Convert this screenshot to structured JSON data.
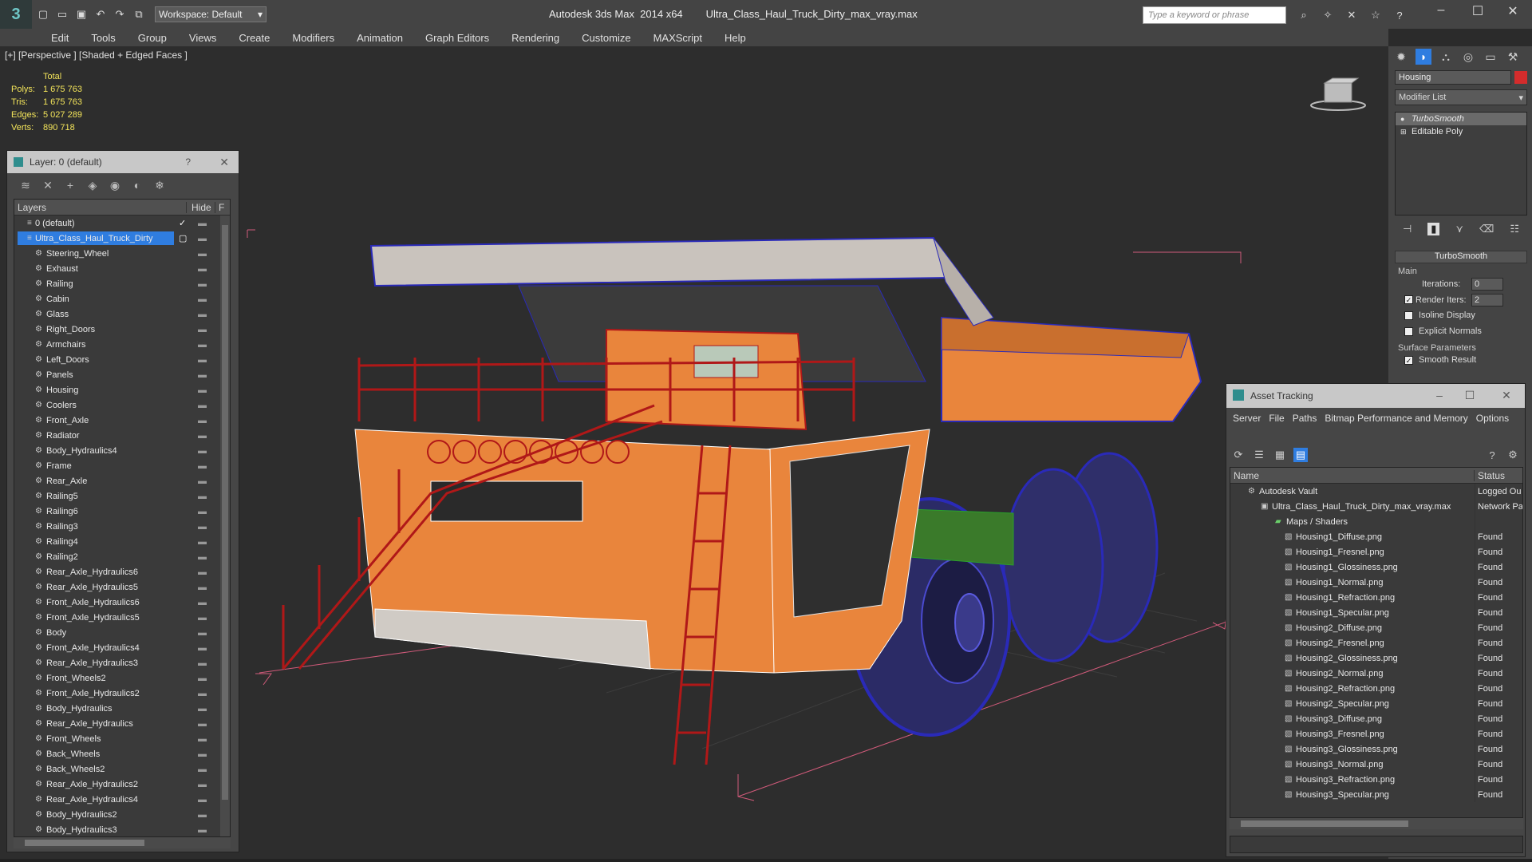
{
  "titlebar": {
    "workspace": "Workspace: Default",
    "app_title": "Autodesk 3ds Max  2014 x64",
    "file_name": "Ultra_Class_Haul_Truck_Dirty_max_vray.max",
    "search_placeholder": "Type a keyword or phrase"
  },
  "menu": [
    "Edit",
    "Tools",
    "Group",
    "Views",
    "Create",
    "Modifiers",
    "Animation",
    "Graph Editors",
    "Rendering",
    "Customize",
    "MAXScript",
    "Help"
  ],
  "viewport": {
    "label": "[+] [Perspective ] [Shaded + Edged Faces ]",
    "stats": {
      "header": "Total",
      "rows": [
        {
          "k": "Polys:",
          "v": "1 675 763"
        },
        {
          "k": "Tris:",
          "v": "1 675 763"
        },
        {
          "k": "Edges:",
          "v": "5 027 289"
        },
        {
          "k": "Verts:",
          "v": "890 718"
        }
      ]
    }
  },
  "layer_panel": {
    "title": "Layer: 0 (default)",
    "help": "?",
    "col_layers": "Layers",
    "col_hide": "Hide",
    "col_freeze": "F",
    "default_layer": "0 (default)",
    "selected_layer": "Ultra_Class_Haul_Truck_Dirty",
    "objects": [
      "Steering_Wheel",
      "Exhaust",
      "Railing",
      "Cabin",
      "Glass",
      "Right_Doors",
      "Armchairs",
      "Left_Doors",
      "Panels",
      "Housing",
      "Coolers",
      "Front_Axle",
      "Radiator",
      "Body_Hydraulics4",
      "Frame",
      "Rear_Axle",
      "Railing5",
      "Railing6",
      "Railing3",
      "Railing4",
      "Railing2",
      "Rear_Axle_Hydraulics6",
      "Rear_Axle_Hydraulics5",
      "Front_Axle_Hydraulics6",
      "Front_Axle_Hydraulics5",
      "Body",
      "Front_Axle_Hydraulics4",
      "Rear_Axle_Hydraulics3",
      "Front_Wheels2",
      "Front_Axle_Hydraulics2",
      "Body_Hydraulics",
      "Rear_Axle_Hydraulics",
      "Front_Wheels",
      "Back_Wheels",
      "Back_Wheels2",
      "Rear_Axle_Hydraulics2",
      "Rear_Axle_Hydraulics4",
      "Body_Hydraulics2",
      "Body_Hydraulics3"
    ]
  },
  "command_panel": {
    "object_name": "Housing",
    "object_color": "#d42c2c",
    "modifier_list": "Modifier List",
    "stack": [
      "TurboSmooth",
      "Editable Poly"
    ],
    "rollout_title": "TurboSmooth",
    "group_main": "Main",
    "iterations_label": "Iterations:",
    "iterations_value": "0",
    "render_iters_label": "Render Iters:",
    "render_iters_value": "2",
    "isoline_label": "Isoline Display",
    "explicit_normals_label": "Explicit Normals",
    "surface_params": "Surface Parameters",
    "smooth_result_label": "Smooth Result"
  },
  "asset_tracking": {
    "title": "Asset Tracking",
    "menu": [
      "Server",
      "File",
      "Paths",
      "Bitmap Performance and Memory",
      "Options"
    ],
    "col_name": "Name",
    "col_status": "Status",
    "vault": {
      "name": "Autodesk Vault",
      "status": "Logged Ou"
    },
    "file": {
      "name": "Ultra_Class_Haul_Truck_Dirty_max_vray.max",
      "status": "Network Pa"
    },
    "maps_folder": "Maps / Shaders",
    "maps": [
      {
        "name": "Housing1_Diffuse.png",
        "status": "Found"
      },
      {
        "name": "Housing1_Fresnel.png",
        "status": "Found"
      },
      {
        "name": "Housing1_Glossiness.png",
        "status": "Found"
      },
      {
        "name": "Housing1_Normal.png",
        "status": "Found"
      },
      {
        "name": "Housing1_Refraction.png",
        "status": "Found"
      },
      {
        "name": "Housing1_Specular.png",
        "status": "Found"
      },
      {
        "name": "Housing2_Diffuse.png",
        "status": "Found"
      },
      {
        "name": "Housing2_Fresnel.png",
        "status": "Found"
      },
      {
        "name": "Housing2_Glossiness.png",
        "status": "Found"
      },
      {
        "name": "Housing2_Normal.png",
        "status": "Found"
      },
      {
        "name": "Housing2_Refraction.png",
        "status": "Found"
      },
      {
        "name": "Housing2_Specular.png",
        "status": "Found"
      },
      {
        "name": "Housing3_Diffuse.png",
        "status": "Found"
      },
      {
        "name": "Housing3_Fresnel.png",
        "status": "Found"
      },
      {
        "name": "Housing3_Glossiness.png",
        "status": "Found"
      },
      {
        "name": "Housing3_Normal.png",
        "status": "Found"
      },
      {
        "name": "Housing3_Refraction.png",
        "status": "Found"
      },
      {
        "name": "Housing3_Specular.png",
        "status": "Found"
      }
    ]
  },
  "colors": {
    "selection": "#2f7de0",
    "stats_text": "#f3e45a",
    "truck_body": "#e9853c",
    "railing_wire": "#b01818",
    "tire_wire": "#2a2ab8"
  }
}
